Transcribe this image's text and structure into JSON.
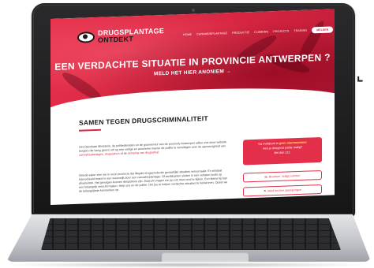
{
  "site": {
    "logo_line1": "DRUGSPLANTAGE",
    "logo_line2": "ONTDEKT",
    "nav": [
      "HOME",
      "CANNABISPLANTAGE",
      "PRODUCTIE",
      "CLIMBING",
      "PROJECTS",
      "TRADING"
    ],
    "nav_button": "MELDEN",
    "hero_title": "EEN VERDACHTE SITUATIE IN PROVINCIE ANTWERPEN ?",
    "hero_cta": "MELD HET HIER ANONIEM  →",
    "section_title": "SAMEN TEGEN DRUGSCRIMINALITEIT",
    "para1_a": "Het Openbaar Ministerie, de politiediensten en de gouverneur van de provincie Antwerpen willen met deze website burgers die bang geven om op een veilige en anonieme manier de politie te verwittigen over de aanwezigheid van ",
    "para1_link": "cannabisplantages, drugslabo's",
    "para1_b": " of de ",
    "para1_link2": "dumping van drugsafval.",
    "para2": "Steeds vaker zien we in onze provincie dat illegale drugsproductie gevaarlijke situaties veroorzaakt. Er ontstaat bijvoorbeeld brand in een woonwijk door een cannabisplantage. Of werkkassen sluiten in een verlaten loods op afvalruimte. Het gevolgen kunnen desastreus zijn. Daarom vragen we jou om mee rond te kijken. Een kleine tip kan een belangrijk verschil maken. Help ons en de politie. Om jou te helpen verdachte situaties te herkennen. Opzet we de belangrijkste kenmerken op.",
    "card_line1": "Ga meldpunt is ",
    "card_highlight": "geen alarmnummer",
    "card_line2": "Heb je dringend politie nodig?",
    "card_line3": "Bel dan 112.",
    "btn1": "Brochure 'veilige ruimtes'",
    "btn2": "Meld het hier aanwijzingen"
  },
  "icons": {
    "arrow": "arrow-right-icon",
    "eye": "eye-logo-icon",
    "doc": "document-icon",
    "flag": "flag-icon"
  },
  "colors": {
    "accent": "#d92642",
    "highlight": "#ffe45c"
  }
}
